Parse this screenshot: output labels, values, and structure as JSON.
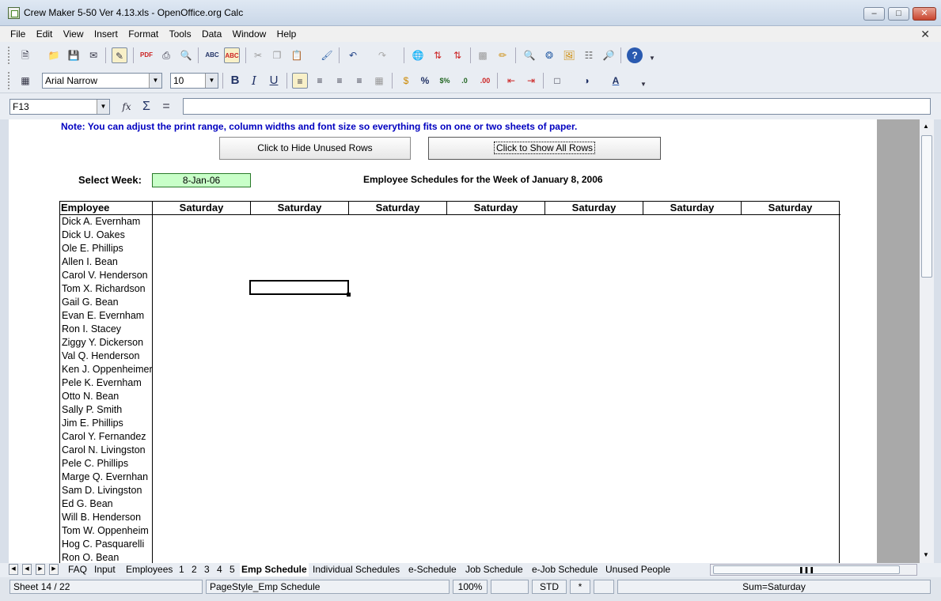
{
  "window": {
    "title": "Crew Maker 5-50 Ver 4.13.xls - OpenOffice.org Calc"
  },
  "menu": [
    "File",
    "Edit",
    "View",
    "Insert",
    "Format",
    "Tools",
    "Data",
    "Window",
    "Help"
  ],
  "toolbar2": {
    "font_name": "Arial Narrow",
    "font_size": "10"
  },
  "formula_bar": {
    "cell_ref": "F13",
    "content": ""
  },
  "sheet": {
    "note": "Note: You can adjust the print range, column widths and font size so everything fits on one or two sheets of paper.",
    "hide_button": "Click to Hide Unused Rows",
    "show_button": "Click to Show All Rows",
    "select_week_label": "Select Week:",
    "week_value": "8-Jan-06",
    "schedule_title": "Employee Schedules for the Week of January 8, 2006",
    "header_employee": "Employee",
    "day_headers": [
      "Saturday",
      "Saturday",
      "Saturday",
      "Saturday",
      "Saturday",
      "Saturday",
      "Saturday"
    ],
    "employees": [
      "Dick A. Evernham",
      "Dick U. Oakes",
      "Ole E. Phillips",
      "Allen I. Bean",
      "Carol V. Henderson",
      "Tom X. Richardson",
      "Gail G. Bean",
      "Evan E. Evernham",
      "Ron I. Stacey",
      "Ziggy Y. Dickerson",
      "Val Q. Henderson",
      "Ken J. Oppenheimer",
      "Pele K. Evernham",
      "Otto N. Bean",
      "Sally P. Smith",
      "Jim E. Phillips",
      "Carol Y. Fernandez",
      "Carol N. Livingston",
      "Pele C. Phillips",
      "Marge Q. Evernhan",
      "Sam D. Livingston",
      "Ed G. Bean",
      "Will B. Henderson",
      "Tom W. Oppenheim",
      "Hog C. Pasquarelli",
      "Ron O. Bean"
    ]
  },
  "tabs": [
    "FAQ",
    "Input",
    "Employees",
    "1",
    "2",
    "3",
    "4",
    "5",
    "Emp Schedule",
    "Individual Schedules",
    "e-Schedule",
    "Job Schedule",
    "e-Job Schedule",
    "Unused People"
  ],
  "active_tab": "Emp Schedule",
  "status": {
    "sheet": "Sheet 14 / 22",
    "page_style": "PageStyle_Emp Schedule",
    "zoom": "100%",
    "mode": "STD",
    "modified": "*",
    "sum": "Sum=Saturday"
  },
  "colors": {
    "note_blue": "#0000c0",
    "week_cell_green": "#c8ffc8"
  }
}
